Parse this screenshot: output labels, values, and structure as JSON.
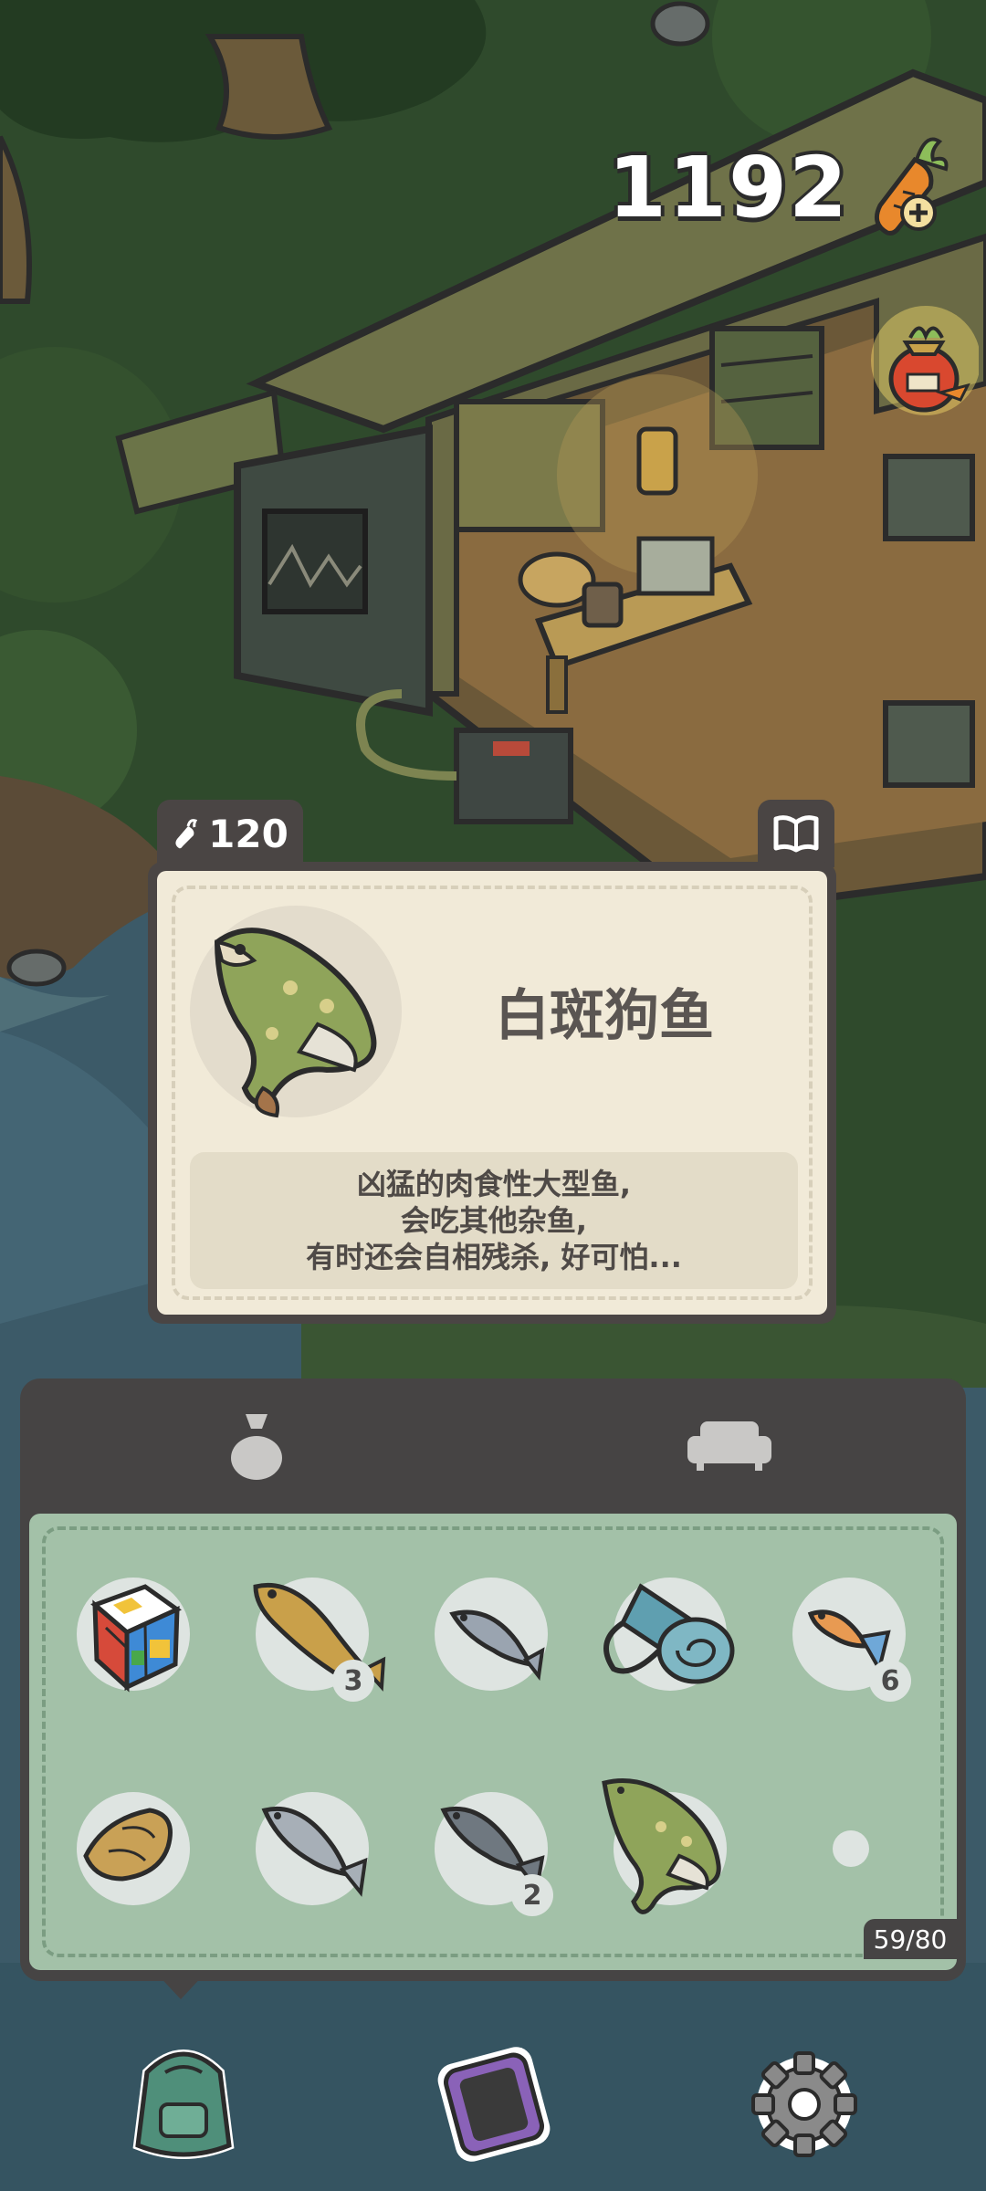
{
  "hud": {
    "currency_amount": "1192",
    "currency_icon": "carrot-plus-icon"
  },
  "item_card": {
    "price": "120",
    "price_icon": "carrot-icon",
    "guide_icon": "book-icon",
    "name": "白斑狗鱼",
    "description_lines": [
      "凶猛的肉食性大型鱼,",
      "会吃其他杂鱼,",
      "有时还会自相残杀, 好可怕..."
    ]
  },
  "inventory": {
    "tabs": [
      {
        "icon": "bag-icon",
        "active": true
      },
      {
        "icon": "sofa-icon",
        "active": false
      }
    ],
    "capacity": "59/80",
    "items": [
      {
        "icon": "rubiks-cube-icon",
        "count": ""
      },
      {
        "icon": "yellow-fish-icon",
        "count": "3"
      },
      {
        "icon": "small-fish-icon",
        "count": ""
      },
      {
        "icon": "sleeping-mat-icon",
        "count": ""
      },
      {
        "icon": "guppy-icon",
        "count": "6"
      },
      {
        "icon": "shell-icon",
        "count": ""
      },
      {
        "icon": "silver-fish-icon",
        "count": ""
      },
      {
        "icon": "dark-fish-icon",
        "count": "2"
      },
      {
        "icon": "pike-icon",
        "count": ""
      }
    ]
  },
  "bottom_nav": [
    {
      "icon": "backpack-icon"
    },
    {
      "icon": "phone-icon"
    },
    {
      "icon": "settings-gear-icon"
    }
  ],
  "colors": {
    "panel_dark": "#464444",
    "inventory_green": "#a3c1a8",
    "card_cream": "#f1ead8",
    "carrot_orange": "#e8882c"
  }
}
